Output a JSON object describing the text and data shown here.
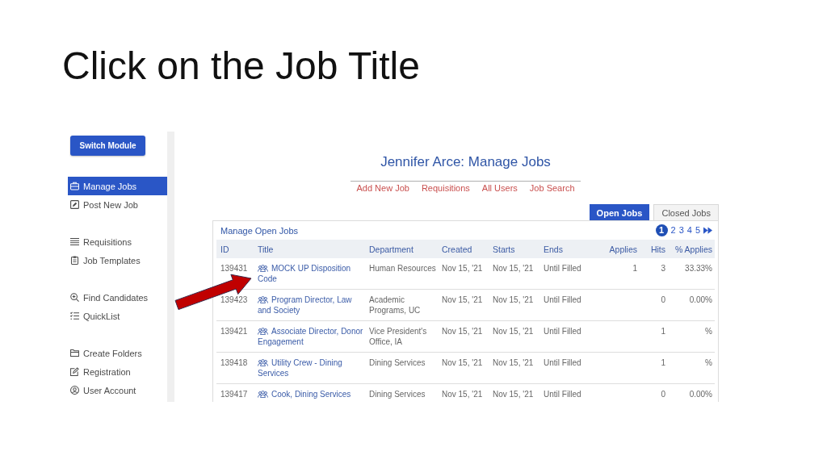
{
  "slide": {
    "title": "Click on the Job Title"
  },
  "sidebar": {
    "button": "Switch Module",
    "groups": [
      {
        "items": [
          {
            "label": "Manage Jobs",
            "selected": true
          },
          {
            "label": "Post New Job",
            "selected": false
          }
        ]
      },
      {
        "items": [
          {
            "label": "Requisitions",
            "selected": false
          },
          {
            "label": "Job Templates",
            "selected": false
          }
        ]
      },
      {
        "items": [
          {
            "label": "Find Candidates",
            "selected": false
          },
          {
            "label": "QuickList",
            "selected": false
          }
        ]
      },
      {
        "items": [
          {
            "label": "Create Folders",
            "selected": false
          },
          {
            "label": "Registration",
            "selected": false
          },
          {
            "label": "User Account",
            "selected": false
          }
        ]
      }
    ]
  },
  "header": {
    "title": "Jennifer Arce: Manage Jobs",
    "links": [
      "Add New Job",
      "Requisitions",
      "All Users",
      "Job Search"
    ]
  },
  "tabs": [
    {
      "label": "Open Jobs",
      "selected": true
    },
    {
      "label": "Closed Jobs",
      "selected": false
    }
  ],
  "panel": {
    "title": "Manage Open Jobs",
    "pages": [
      {
        "label": "1",
        "selected": true
      },
      {
        "label": "2",
        "selected": false
      },
      {
        "label": "3",
        "selected": false
      },
      {
        "label": "4",
        "selected": false
      },
      {
        "label": "5",
        "selected": false
      }
    ]
  },
  "table": {
    "columns": [
      {
        "label": "ID",
        "kind": "text"
      },
      {
        "label": "Title",
        "kind": "link"
      },
      {
        "label": "Department",
        "kind": "text"
      },
      {
        "label": "Created",
        "kind": "text"
      },
      {
        "label": "Starts",
        "kind": "text"
      },
      {
        "label": "Ends",
        "kind": "text"
      },
      {
        "label": "Applies",
        "kind": "number"
      },
      {
        "label": "Hits",
        "kind": "number"
      },
      {
        "label": "% Applies",
        "kind": "number"
      }
    ],
    "rows": [
      {
        "id": "139431",
        "title": "MOCK UP Disposition Code",
        "department": "Human Resources",
        "created": "Nov 15, '21",
        "starts": "Nov 15, '21",
        "ends": "Until Filled",
        "applies": "1",
        "hits": "3",
        "percent_applies": "33.33%"
      },
      {
        "id": "139423",
        "title": "Program Director, Law and Society",
        "department": "Academic Programs, UC",
        "created": "Nov 15, '21",
        "starts": "Nov 15, '21",
        "ends": "Until Filled",
        "hits": "0",
        "percent_applies": "0.00%"
      },
      {
        "id": "139421",
        "title": "Associate Director, Donor Engagement",
        "department": "Vice President's Office, IA",
        "created": "Nov 15, '21",
        "starts": "Nov 15, '21",
        "ends": "Until Filled",
        "hits": "1",
        "percent_applies": "%"
      },
      {
        "id": "139418",
        "title": "Utility Crew - Dining Services",
        "department": "Dining Services",
        "created": "Nov 15, '21",
        "starts": "Nov 15, '21",
        "ends": "Until Filled",
        "hits": "1",
        "percent_applies": "%"
      },
      {
        "id": "139417",
        "title": "Cook, Dining Services",
        "department": "Dining Services",
        "created": "Nov 15, '21",
        "starts": "Nov 15, '21",
        "ends": "Until Filled",
        "hits": "0",
        "percent_applies": "0.00%"
      }
    ]
  }
}
